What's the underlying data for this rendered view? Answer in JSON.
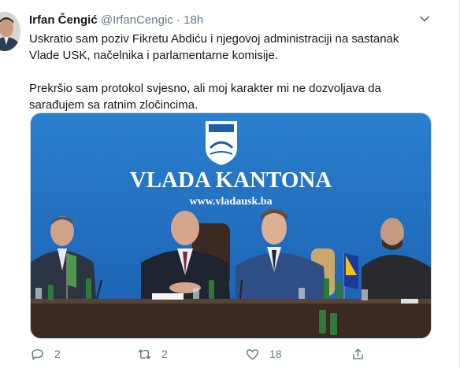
{
  "tweet": {
    "author_name": "Irfan Čengić",
    "handle": "@IrfanCengic",
    "separator": "·",
    "time": "18h",
    "paragraphs": [
      "Uskratio sam poziv Fikretu Abdiću i njegovoj administraciji na sastanak Vlade USK, načelnika i parlamentarne komisije.",
      "Prekršio sam protokol svjesno, ali moj karakter mi ne dozvoljava da sarađujem sa ratnim zločincima."
    ],
    "media": {
      "banner_title": "VLADA KANTONA",
      "banner_url": "www.vladausk.ba",
      "colors": {
        "backdrop": "#1f6fc0",
        "table": "#3a2a22"
      }
    },
    "actions": {
      "reply_count": "2",
      "retweet_count": "2",
      "like_count": "18",
      "icons": [
        "reply-icon",
        "retweet-icon",
        "like-icon",
        "share-icon"
      ]
    }
  }
}
